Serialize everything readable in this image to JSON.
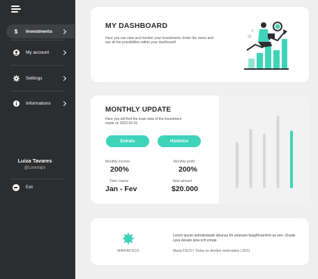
{
  "sidebar": {
    "items": [
      {
        "label": "Investments",
        "icon": "dollar-icon",
        "glyph": "$",
        "active": true
      },
      {
        "label": "My account",
        "icon": "user-icon",
        "glyph": "●",
        "active": false
      },
      {
        "label": "Settings",
        "icon": "gear-icon",
        "glyph": "✱",
        "active": false
      },
      {
        "label": "Informations",
        "icon": "info-icon",
        "glyph": "●",
        "active": false
      }
    ],
    "user": {
      "name": "Luiza Tavares",
      "handle": "@Loremips"
    },
    "exit_label": "Exit"
  },
  "dashboard": {
    "title": "MY DASHBOARD",
    "description": "Here you can view and monitor your investments. Enter the menu and see all the possibilities within your dashboard!"
  },
  "monthly": {
    "title": "MONTHLY UPDATE",
    "subtitle": "Here you will find the main data of the investment made on 2022-02-01",
    "buttons": {
      "extrato": "Extrato",
      "historico": "Histórico"
    },
    "stats": {
      "income_label": "Monthly income",
      "income_value": "200%",
      "profit_label": "Monthly profit",
      "profit_value": "200%",
      "course_label": "Time course",
      "course_value": "Jan - Fev",
      "total_label": "total amount",
      "total_value": "$20.000"
    }
  },
  "chart_data": {
    "type": "bar",
    "values": [
      0.58,
      0.74,
      0.68,
      0.9,
      0.72
    ],
    "highlight_index": 4
  },
  "footer": {
    "brand": "MARIAFSCO",
    "text": "Lorem ipsum astrodeskade dinunas för antesam fasigförsamhet av nen. Onade vyva derade pina och.cringe.",
    "copyright": "Maria FSCO  |  Todos os direitos reservados | 2021"
  },
  "colors": {
    "accent": "#3fd4b9",
    "sidebar": "#2c2d2f",
    "bars": "#d7d7d7"
  }
}
